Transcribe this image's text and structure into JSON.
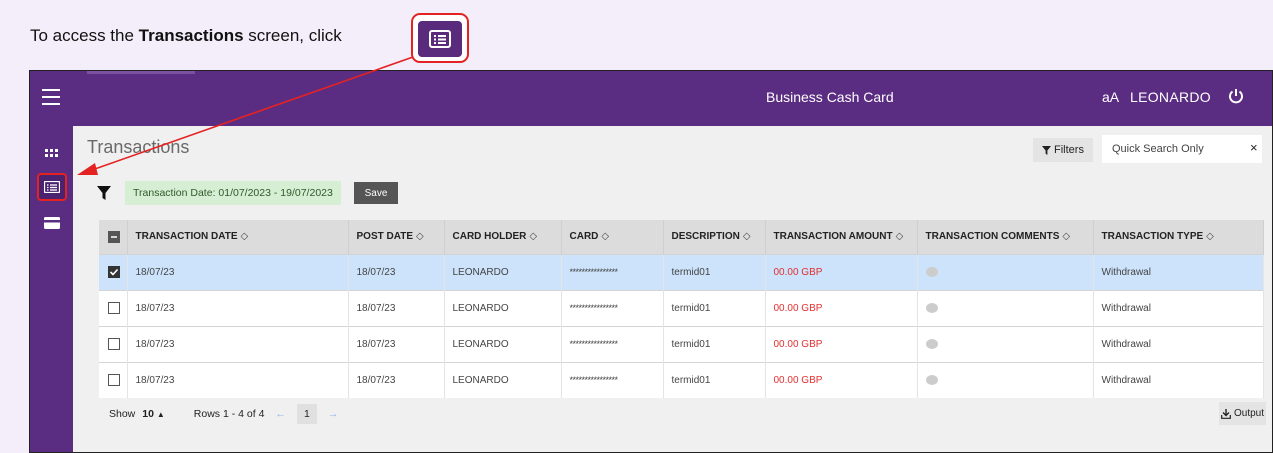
{
  "instruction": {
    "prefix": "To access the ",
    "bold": "Transactions",
    "suffix": " screen, click"
  },
  "header": {
    "title": "Business Cash Card",
    "font_toggle": "aA",
    "user": "LEONARDO"
  },
  "page": {
    "title": "Transactions"
  },
  "toolbar": {
    "filters_label": "Filters",
    "search_placeholder": "Quick Search Only",
    "clear": "×"
  },
  "filter": {
    "chip_label": "Transaction Date: 01/07/2023 - 19/07/2023",
    "save_label": "Save"
  },
  "table": {
    "columns": [
      "TRANSACTION DATE",
      "POST DATE",
      "CARD HOLDER",
      "CARD",
      "DESCRIPTION",
      "TRANSACTION AMOUNT",
      "TRANSACTION COMMENTS",
      "TRANSACTION TYPE"
    ],
    "sort_glyph": "◇",
    "rows": [
      {
        "selected": true,
        "transaction_date": "18/07/23",
        "post_date": "18/07/23",
        "card_holder": "LEONARDO",
        "card": "****************",
        "description": "termid01",
        "amount": "00.00 GBP",
        "type": "Withdrawal"
      },
      {
        "selected": false,
        "transaction_date": "18/07/23",
        "post_date": "18/07/23",
        "card_holder": "LEONARDO",
        "card": "****************",
        "description": "termid01",
        "amount": "00.00 GBP",
        "type": "Withdrawal"
      },
      {
        "selected": false,
        "transaction_date": "18/07/23",
        "post_date": "18/07/23",
        "card_holder": "LEONARDO",
        "card": "****************",
        "description": "termid01",
        "amount": "00.00 GBP",
        "type": "Withdrawal"
      },
      {
        "selected": false,
        "transaction_date": "18/07/23",
        "post_date": "18/07/23",
        "card_holder": "LEONARDO",
        "card": "****************",
        "description": "termid01",
        "amount": "00.00 GBP",
        "type": "Withdrawal"
      }
    ]
  },
  "pager": {
    "show_label": "Show",
    "show_value": "10",
    "show_caret": "▲",
    "rows_info": "Rows 1 - 4 of 4",
    "prev": "←",
    "page": "1",
    "next": "→"
  },
  "output": {
    "label": "Output"
  },
  "colors": {
    "brand_purple": "#5b2d82",
    "annotation_red": "#e52222",
    "selected_row": "#cce3fb",
    "amount_red": "#e03030"
  },
  "icons": [
    "list-icon",
    "hamburger-icon",
    "power-icon",
    "grid-icon",
    "card-icon",
    "funnel-icon",
    "download-icon",
    "comment-icon",
    "close-icon"
  ]
}
